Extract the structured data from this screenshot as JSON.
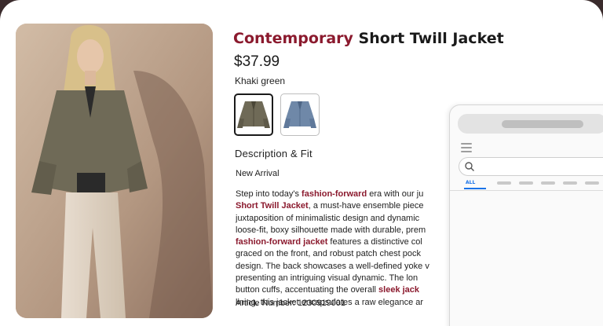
{
  "product": {
    "title_accent": "Contemporary",
    "title_rest": " Short Twill Jacket",
    "price": "$37.99",
    "color_name": "Khaki green",
    "description_heading": "Description & Fit",
    "badge": "New Arrival",
    "description_lines": [
      [
        {
          "t": "Step into today's "
        },
        {
          "t": "fashion-forward",
          "b": true
        },
        {
          "t": " era with our ju"
        }
      ],
      [
        {
          "t": "Short Twill Jacket",
          "b": true
        },
        {
          "t": ", a must-have ensemble piece"
        }
      ],
      [
        {
          "t": "juxtaposition of minimalistic design and dynamic"
        }
      ],
      [
        {
          "t": "loose-fit, boxy silhouette made with durable, prem"
        }
      ],
      [
        {
          "t": "fashion-forward jacket",
          "b": true
        },
        {
          "t": " features a distinctive col"
        }
      ],
      [
        {
          "t": "graced on the front, and robust patch chest pock"
        }
      ],
      [
        {
          "t": "design. The back showcases a well-defined yoke v"
        }
      ],
      [
        {
          "t": "presenting an intriguing visual dynamic. The lon"
        }
      ],
      [
        {
          "t": "button cuffs, accentuating the overall "
        },
        {
          "t": "sleek jack",
          "b": true
        }
      ],
      [
        {
          "t": "lining, this jacket encapsulates a raw elegance ar"
        }
      ]
    ],
    "article_number": "Article Number: 1230919001",
    "swatches": [
      {
        "name": "Khaki green",
        "color": "#6f6a57",
        "selected": true
      },
      {
        "name": "Denim blue",
        "color": "#6f88a8",
        "selected": false
      }
    ]
  },
  "overlay": {
    "tab_all": "ALL"
  },
  "colors": {
    "accent": "#8b1a2e",
    "text": "#1a1a1a",
    "search_tab_blue": "#1a73e8"
  }
}
